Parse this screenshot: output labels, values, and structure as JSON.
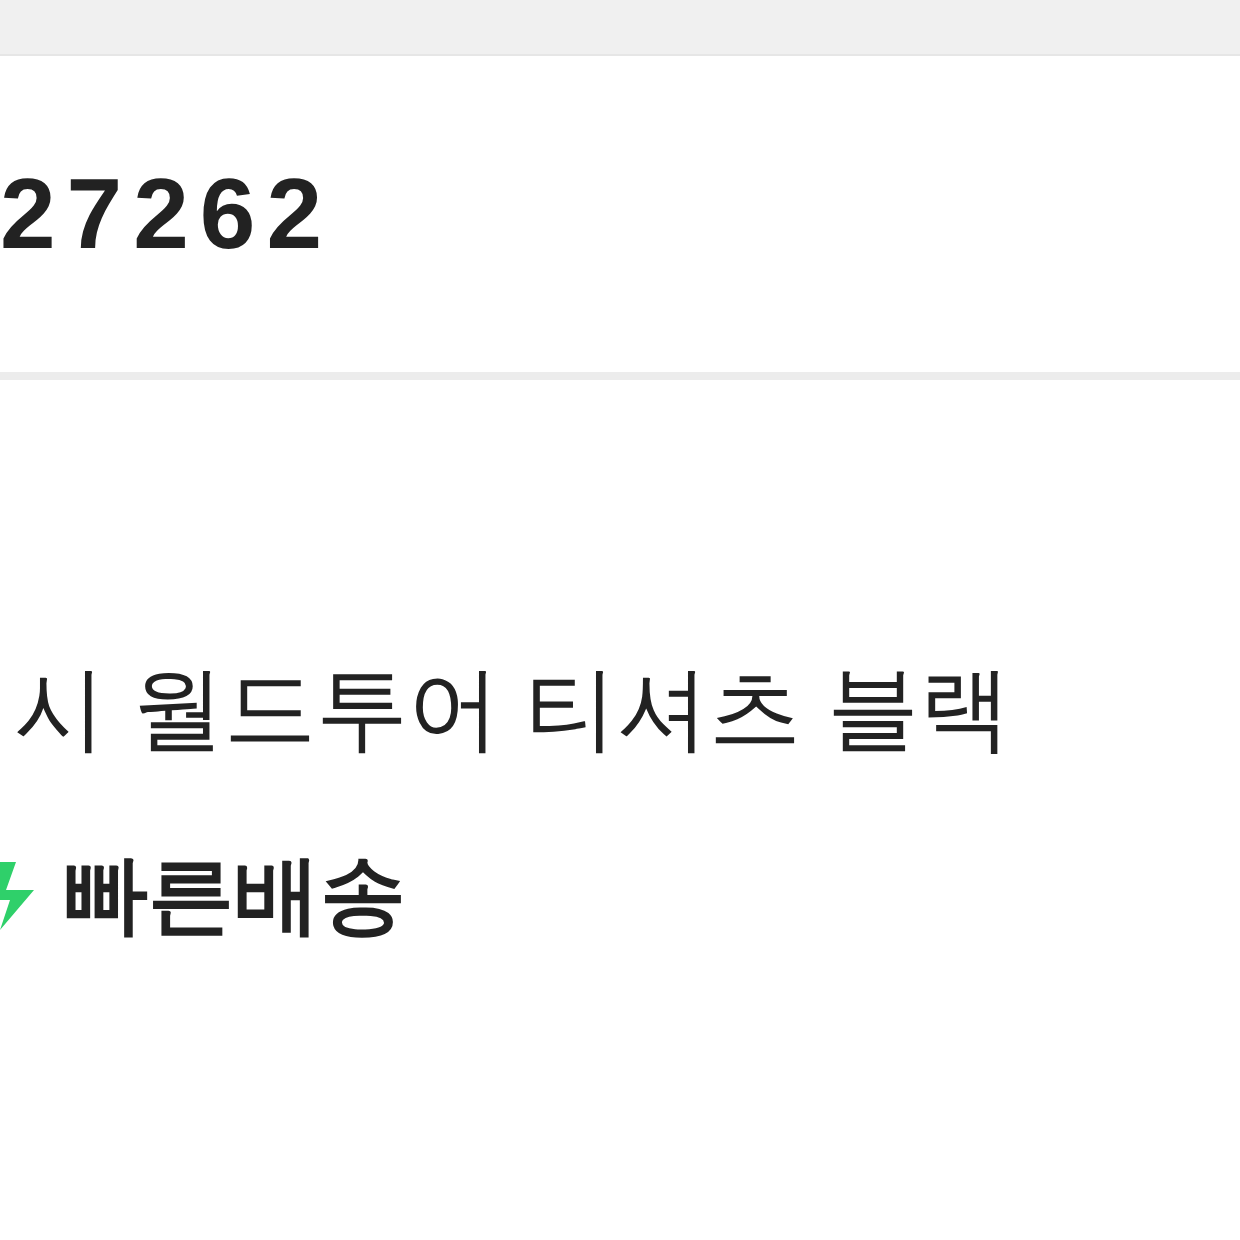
{
  "order": {
    "number": "27262"
  },
  "product": {
    "title": "시 월드투어 티셔츠 블랙",
    "delivery_badge": {
      "label": "빠른배송"
    }
  }
}
